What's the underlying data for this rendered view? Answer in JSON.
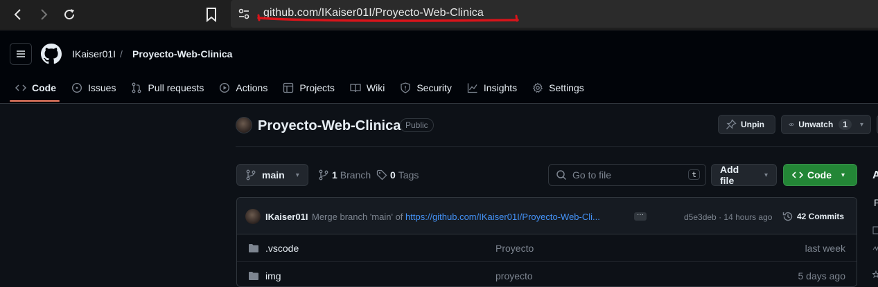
{
  "browser": {
    "url": "github.com/IKaiser01I/Proyecto-Web-Clinica"
  },
  "header": {
    "owner": "IKaiser01I",
    "separator": "/",
    "repo": "Proyecto-Web-Clinica"
  },
  "tabs": [
    {
      "label": "Code",
      "icon": "code-icon"
    },
    {
      "label": "Issues",
      "icon": "issue-icon"
    },
    {
      "label": "Pull requests",
      "icon": "pull-request-icon"
    },
    {
      "label": "Actions",
      "icon": "play-icon"
    },
    {
      "label": "Projects",
      "icon": "table-icon"
    },
    {
      "label": "Wiki",
      "icon": "book-icon"
    },
    {
      "label": "Security",
      "icon": "shield-icon"
    },
    {
      "label": "Insights",
      "icon": "graph-icon"
    },
    {
      "label": "Settings",
      "icon": "gear-icon"
    }
  ],
  "repo": {
    "name": "Proyecto-Web-Clinica",
    "visibility": "Public",
    "unpin_label": "Unpin",
    "unwatch_label": "Unwatch",
    "watch_count": "1"
  },
  "toolbar": {
    "branch": "main",
    "branch_count": "1",
    "branch_label": "Branch",
    "tag_count": "0",
    "tag_label": "Tags",
    "goto_placeholder": "Go to file",
    "goto_shortcut": "t",
    "add_file_label": "Add file",
    "code_label": "Code"
  },
  "sidebar": {
    "heading_fragment": "A",
    "text_fragment": "P"
  },
  "commit": {
    "author": "IKaiser01I",
    "message_prefix": "Merge branch 'main' of ",
    "message_link": "https://github.com/IKaiser01I/Proyecto-Web-Cli...",
    "hash": "d5e3deb",
    "time": "· 14 hours ago",
    "commits": "42 Commits"
  },
  "files": [
    {
      "name": ".vscode",
      "message": "Proyecto",
      "date": "last week"
    },
    {
      "name": "img",
      "message": "proyecto",
      "date": "5 days ago"
    }
  ],
  "colors": {
    "accent_orange": "#f78166",
    "code_green": "#238636",
    "link_blue": "#4493f8",
    "annotation_red": "#d9141a"
  }
}
